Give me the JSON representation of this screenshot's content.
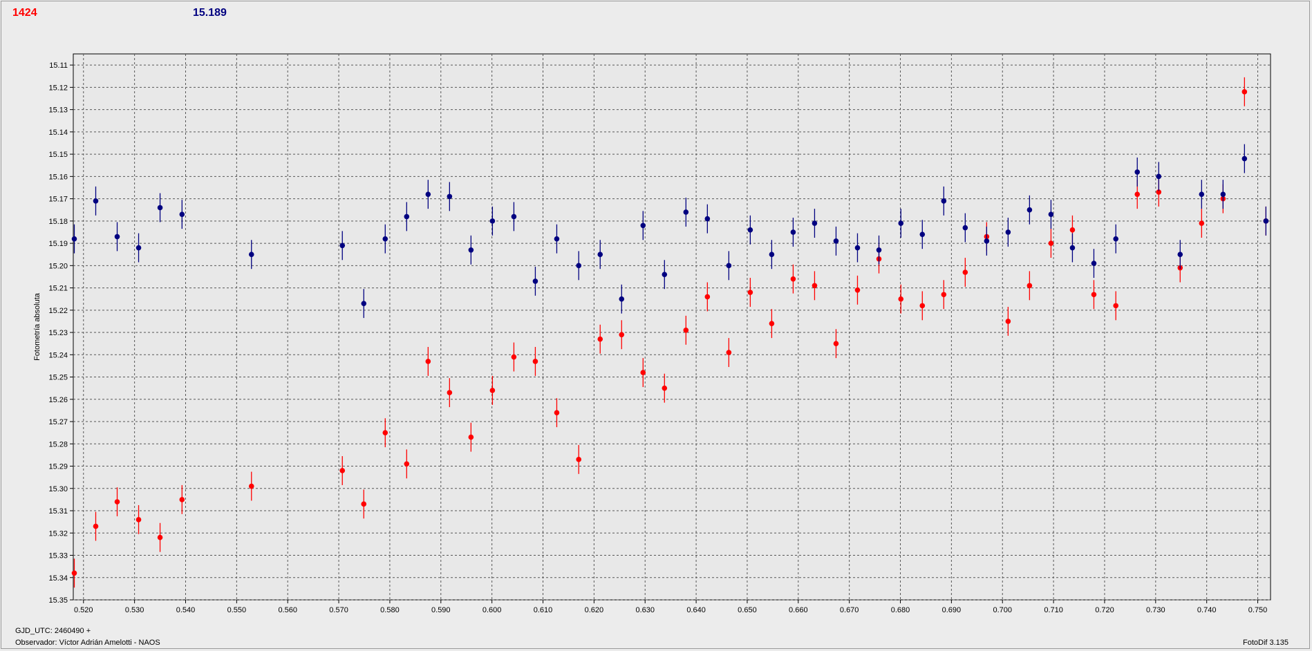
{
  "header": {
    "comparison_count": "1424",
    "mean_magnitude": "15.189"
  },
  "footer": {
    "epoch": "GJD_UTC: 2460490 +",
    "observer": "Observador: Víctor Adrián Amelotti - NAOS",
    "software": "FotoDif 3.135"
  },
  "chart_data": {
    "type": "scatter",
    "title": "",
    "xlabel": "",
    "ylabel": "Fotometría absoluta",
    "xlim": [
      0.518,
      0.7525
    ],
    "ylim": [
      15.35,
      15.105
    ],
    "y_inverted": true,
    "grid": true,
    "x_ticks": [
      "0.520",
      "0.530",
      "0.540",
      "0.550",
      "0.560",
      "0.570",
      "0.580",
      "0.590",
      "0.600",
      "0.610",
      "0.620",
      "0.630",
      "0.640",
      "0.650",
      "0.660",
      "0.670",
      "0.680",
      "0.690",
      "0.700",
      "0.710",
      "0.720",
      "0.730",
      "0.740",
      "0.750"
    ],
    "y_ticks": [
      "15.11",
      "15.12",
      "15.13",
      "15.14",
      "15.15",
      "15.16",
      "15.17",
      "15.18",
      "15.19",
      "15.20",
      "15.21",
      "15.22",
      "15.23",
      "15.24",
      "15.25",
      "15.26",
      "15.27",
      "15.28",
      "15.29",
      "15.30",
      "15.31",
      "15.32",
      "15.33",
      "15.34",
      "15.35"
    ],
    "error_bar": 0.0065,
    "series": [
      {
        "color": "#ff0000",
        "x": [
          0.5182,
          0.5224,
          0.5266,
          0.5308,
          0.535,
          0.5393,
          0.5529,
          0.5707,
          0.5749,
          0.5791,
          0.5833,
          0.5875,
          0.5917,
          0.5959,
          0.6001,
          0.6043,
          0.6085,
          0.6127,
          0.617,
          0.6212,
          0.6254,
          0.6296,
          0.6338,
          0.638,
          0.6422,
          0.6464,
          0.6506,
          0.6548,
          0.659,
          0.6632,
          0.6674,
          0.6716,
          0.6758,
          0.6801,
          0.6843,
          0.6885,
          0.6927,
          0.6969,
          0.7011,
          0.7053,
          0.7095,
          0.7137,
          0.7179,
          0.7222,
          0.7264,
          0.7306,
          0.7348,
          0.739,
          0.7432,
          0.7474,
          0.7516
        ],
        "y": [
          15.338,
          15.317,
          15.306,
          15.314,
          15.322,
          15.305,
          15.299,
          15.292,
          15.307,
          15.275,
          15.289,
          15.243,
          15.257,
          15.277,
          15.256,
          15.241,
          15.243,
          15.266,
          15.287,
          15.233,
          15.231,
          15.248,
          15.255,
          15.229,
          15.214,
          15.239,
          15.212,
          15.226,
          15.206,
          15.209,
          15.235,
          15.211,
          15.197,
          15.215,
          15.218,
          15.213,
          15.203,
          15.187,
          15.225,
          15.209,
          15.19,
          15.184,
          15.213,
          15.218,
          15.168,
          15.167,
          15.201,
          15.181,
          15.17,
          15.122,
          15.18
        ]
      },
      {
        "color": "#000080",
        "x": [
          0.5182,
          0.5224,
          0.5266,
          0.5308,
          0.535,
          0.5393,
          0.5529,
          0.5707,
          0.5749,
          0.5791,
          0.5833,
          0.5875,
          0.5917,
          0.5959,
          0.6001,
          0.6043,
          0.6085,
          0.6127,
          0.617,
          0.6212,
          0.6254,
          0.6296,
          0.6338,
          0.638,
          0.6422,
          0.6464,
          0.6506,
          0.6548,
          0.659,
          0.6632,
          0.6674,
          0.6716,
          0.6758,
          0.6801,
          0.6843,
          0.6885,
          0.6927,
          0.6969,
          0.7011,
          0.7053,
          0.7095,
          0.7137,
          0.7179,
          0.7222,
          0.7264,
          0.7306,
          0.7348,
          0.739,
          0.7432,
          0.7474,
          0.7516
        ],
        "y": [
          15.188,
          15.171,
          15.187,
          15.192,
          15.174,
          15.177,
          15.195,
          15.191,
          15.217,
          15.188,
          15.178,
          15.168,
          15.169,
          15.193,
          15.18,
          15.178,
          15.207,
          15.188,
          15.2,
          15.195,
          15.215,
          15.182,
          15.204,
          15.176,
          15.179,
          15.2,
          15.184,
          15.195,
          15.185,
          15.181,
          15.189,
          15.192,
          15.193,
          15.181,
          15.186,
          15.171,
          15.183,
          15.189,
          15.185,
          15.175,
          15.177,
          15.192,
          15.199,
          15.188,
          15.158,
          15.16,
          15.195,
          15.168,
          15.168,
          15.152,
          15.18
        ]
      }
    ]
  }
}
